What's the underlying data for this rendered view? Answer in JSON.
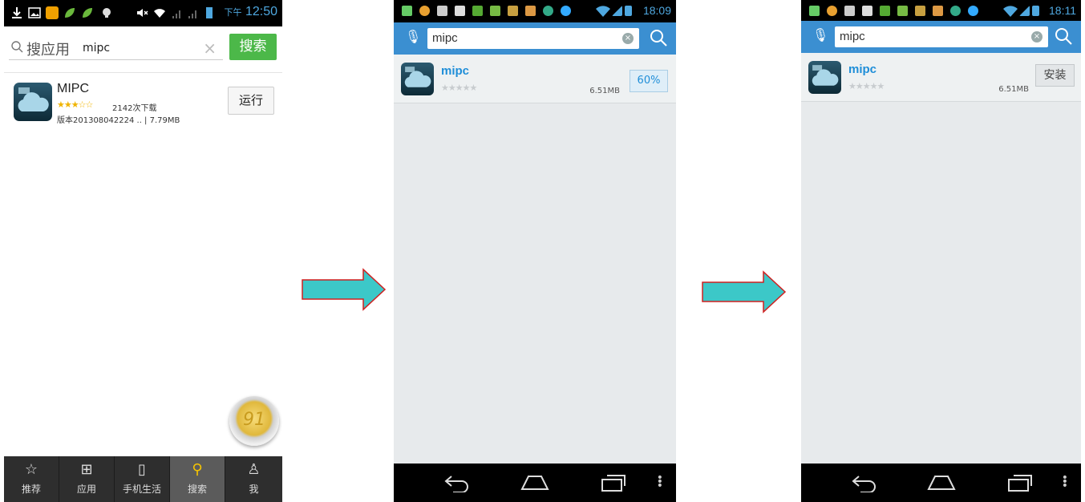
{
  "colors": {
    "accent_blue": "#3b8fd1",
    "link_blue": "#1f8ed8",
    "search_green": "#4cb849",
    "arrow_fill": "#3cc8c8",
    "arrow_stroke": "#d02020"
  },
  "screen1": {
    "status_time_prefix": "下午",
    "status_time": "12:50",
    "search_category": "搜应用",
    "search_query": "mipc",
    "search_button": "搜索",
    "app": {
      "name": "MIPC",
      "stars": "★★★☆☆",
      "downloads": "2142次下载",
      "version": "版本201308042224 .. | 7.79MB",
      "action": "运行"
    },
    "float_badge": "91",
    "nav": [
      {
        "label": "推荐",
        "icon": "star-icon",
        "glyph": "☆"
      },
      {
        "label": "应用",
        "icon": "grid-icon",
        "glyph": "⊞"
      },
      {
        "label": "手机生活",
        "icon": "phone-icon",
        "glyph": "▯"
      },
      {
        "label": "搜索",
        "icon": "search-icon",
        "glyph": "⚲"
      },
      {
        "label": "我",
        "icon": "user-icon",
        "glyph": "♙"
      }
    ]
  },
  "screen2": {
    "status_time": "18:09",
    "search_query": "mipc",
    "app": {
      "name": "mipc",
      "stars": "★★★★★",
      "size": "6.51MB",
      "progress_label": "60%",
      "progress": 0.6
    }
  },
  "screen3": {
    "status_time": "18:11",
    "search_query": "mipc",
    "app": {
      "name": "mipc",
      "stars": "★★★★★",
      "size": "6.51MB",
      "action": "安装"
    }
  }
}
